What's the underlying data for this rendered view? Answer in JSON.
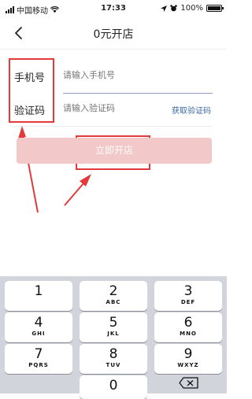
{
  "status": {
    "carrier": "中国移动",
    "time": "17:33",
    "battery": "100%"
  },
  "nav": {
    "title": "0元开店"
  },
  "form": {
    "phone_label": "手机号",
    "phone_placeholder": "请输入手机号",
    "code_label": "验证码",
    "code_placeholder": "请输入验证码",
    "get_code": "获取验证码"
  },
  "submit_label": "立即开店",
  "keypad": {
    "keys": [
      {
        "num": "1",
        "letters": ""
      },
      {
        "num": "2",
        "letters": "ABC"
      },
      {
        "num": "3",
        "letters": "DEF"
      },
      {
        "num": "4",
        "letters": "GHI"
      },
      {
        "num": "5",
        "letters": "JKL"
      },
      {
        "num": "6",
        "letters": "MNO"
      },
      {
        "num": "7",
        "letters": "PQRS"
      },
      {
        "num": "8",
        "letters": "TUV"
      },
      {
        "num": "9",
        "letters": "WXYZ"
      },
      {
        "num": "0",
        "letters": ""
      }
    ]
  },
  "colors": {
    "annotation": "#e23a3a",
    "submit_bg": "#f3c8c8",
    "link": "#3a67a6"
  }
}
